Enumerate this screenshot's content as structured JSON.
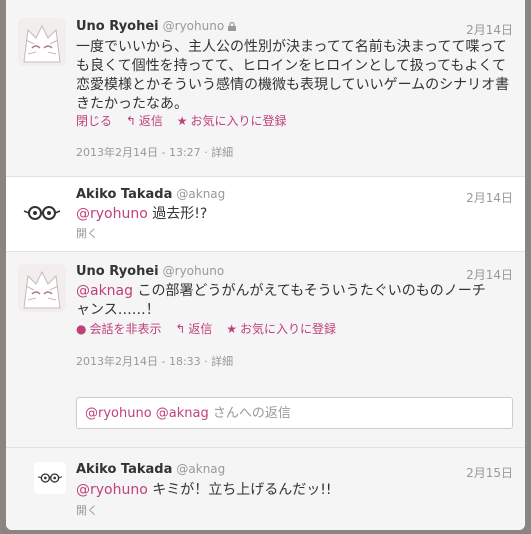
{
  "tweets": [
    {
      "name": "Uno Ryohei",
      "handle": "@ryohuno",
      "date": "2月14日",
      "text": "一度でいいから、主人公の性別が決まってて名前も決まってて喋っても良くて個性を持ってて、ヒロインをヒロインとして扱ってもよくて恋愛模様とかそういう感情の機微も表現していいゲームのシナリオ書きたかったなあ。",
      "actions": {
        "close": "閉じる",
        "reply": "返信",
        "fav": "お気に入りに登録"
      },
      "meta": "2013年2月14日 - 13:27 · 詳細"
    },
    {
      "name": "Akiko Takada",
      "handle": "@aknag",
      "date": "2月14日",
      "mention": "@ryohuno",
      "text": " 過去形!?",
      "open": "開く"
    },
    {
      "name": "Uno Ryohei",
      "handle": "@ryohuno",
      "date": "2月14日",
      "mention": "@aknag",
      "text": " この部署どうがんがえてもそういうたぐいのものノーチャンス……！",
      "actions": {
        "hide": "会話を非表示",
        "reply": "返信",
        "fav": "お気に入りに登録"
      },
      "meta": "2013年2月14日 - 18:33 · 詳細"
    },
    {
      "name": "Akiko Takada",
      "handle": "@aknag",
      "date": "2月15日",
      "mention": "@ryohuno",
      "text": " キミが！立ち上げるんだッ!!",
      "open": "開く"
    }
  ],
  "reply": {
    "mentions": "@ryohuno @aknag",
    "suffix": " さんへの返信"
  },
  "colors": {
    "accent": "#c0407b",
    "muted": "#999999"
  },
  "icons": [
    "lock-icon",
    "reply-icon",
    "star-icon",
    "speech-bubble-icon"
  ]
}
